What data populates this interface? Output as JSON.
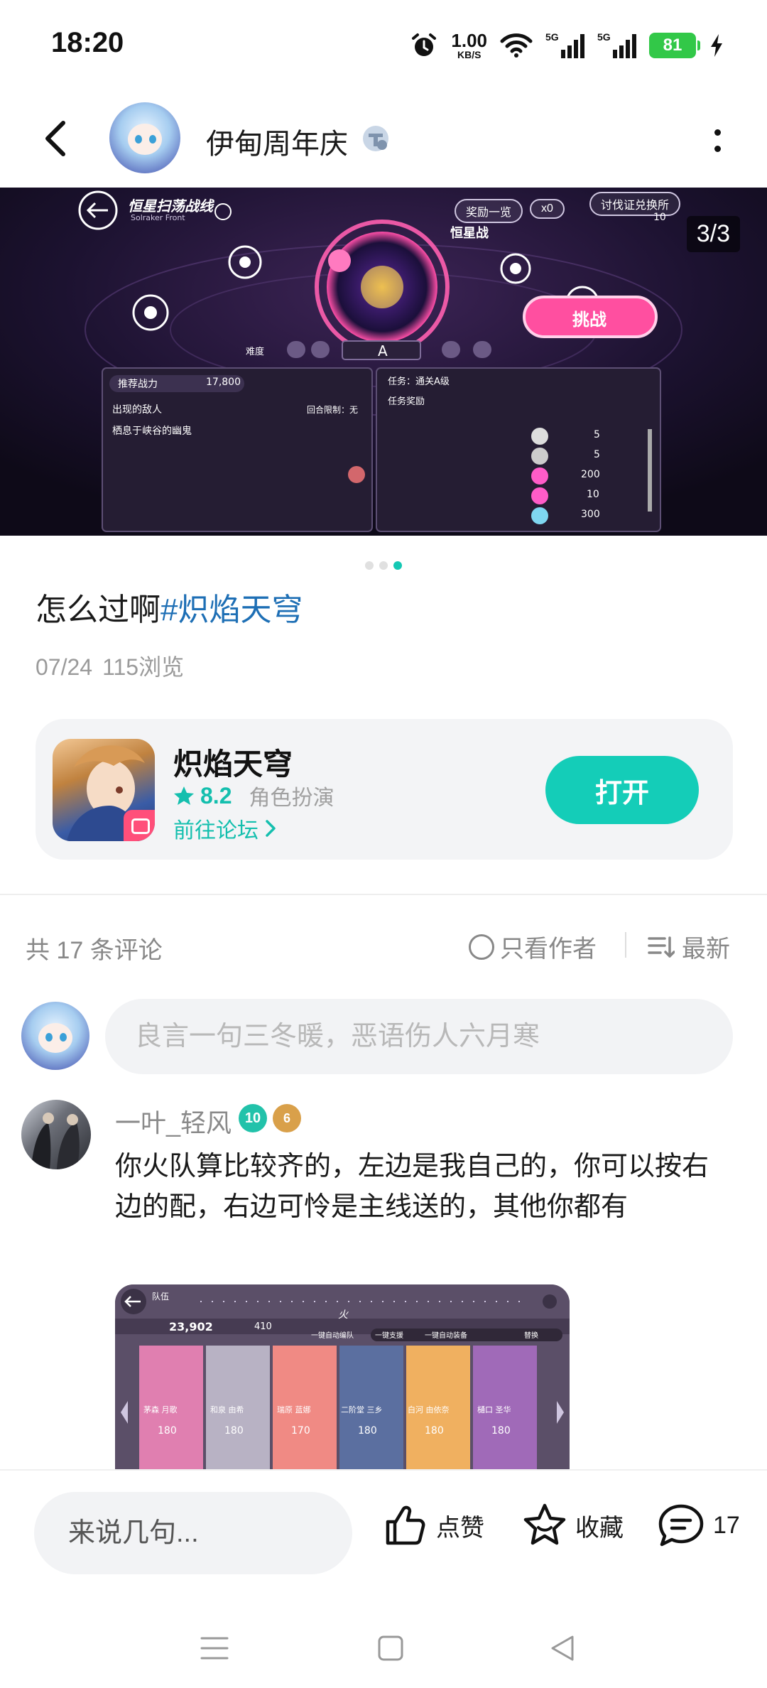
{
  "status_bar": {
    "time": "18:20",
    "net_speed_value": "1.00",
    "net_speed_unit": "KB/S",
    "sim1": "5G",
    "sim2": "5G",
    "battery": "81"
  },
  "header": {
    "title": "伊甸周年庆"
  },
  "banner": {
    "counter": "3/3",
    "game_texts": {
      "stage_title": "恒星扫荡战线",
      "stage_sub": "Solraker Front",
      "reward_list": "奖励一览",
      "item_count": "x0",
      "exchange": "讨伐证兑换所",
      "exchange_count": "10",
      "boss_label": "恒星战",
      "challenge": "挑战",
      "difficulty_label": "难度",
      "difficulty_value": "A",
      "power_label": "推荐战力",
      "power_value": "17,800",
      "enemy_label": "出现的敌人",
      "turn_limit": "回合限制：无",
      "enemy_name": "栖息于峡谷的幽鬼",
      "task_label": "任务：通关A级",
      "task_reward": "任务奖励",
      "rewards": [
        "5",
        "5",
        "200",
        "10",
        "300"
      ]
    }
  },
  "carousel": {
    "count": 3,
    "active": 2
  },
  "post": {
    "text_plain": "怎么过啊",
    "hashtag": "#炽焰天穹",
    "date": "07/24",
    "views": "115浏览"
  },
  "game_card": {
    "name": "炽焰天穹",
    "rating": "8.2",
    "genre": "角色扮演",
    "forum_link": "前往论坛",
    "open_button": "打开"
  },
  "comments": {
    "count_label": "共 17 条评论",
    "author_only": "只看作者",
    "sort_label": "最新",
    "input_placeholder": "良言一句三冬暖，恶语伤人六月寒",
    "items": [
      {
        "username": "一叶_轻风",
        "level_badge": "10",
        "title_badge": "6",
        "body": "你火队算比较齐的，左边是我自己的，你可以按右边的配，右边可怜是主线送的，其他你都有",
        "image_texts": {
          "team_label": "队伍",
          "total_power": "23,902",
          "leader_level": "410",
          "element": "火",
          "buttons": [
            "一键自动编队",
            "一键支援",
            "一键自动装备",
            "替换"
          ],
          "characters": [
            "茅森 月歌",
            "和泉 由希",
            "瑞原 蓝娜",
            "二阶堂 三乡",
            "白河 由依奈",
            "樋口 圣华"
          ],
          "levels": [
            "180",
            "180",
            "170",
            "180",
            "180",
            "180"
          ]
        }
      }
    ]
  },
  "bottom_bar": {
    "input_placeholder": "来说几句...",
    "like_label": "点赞",
    "fav_label": "收藏",
    "comment_count": "17"
  },
  "colors": {
    "accent": "#14cdb8",
    "hashtag": "#1e6fb5",
    "muted": "#8a8a8a"
  }
}
